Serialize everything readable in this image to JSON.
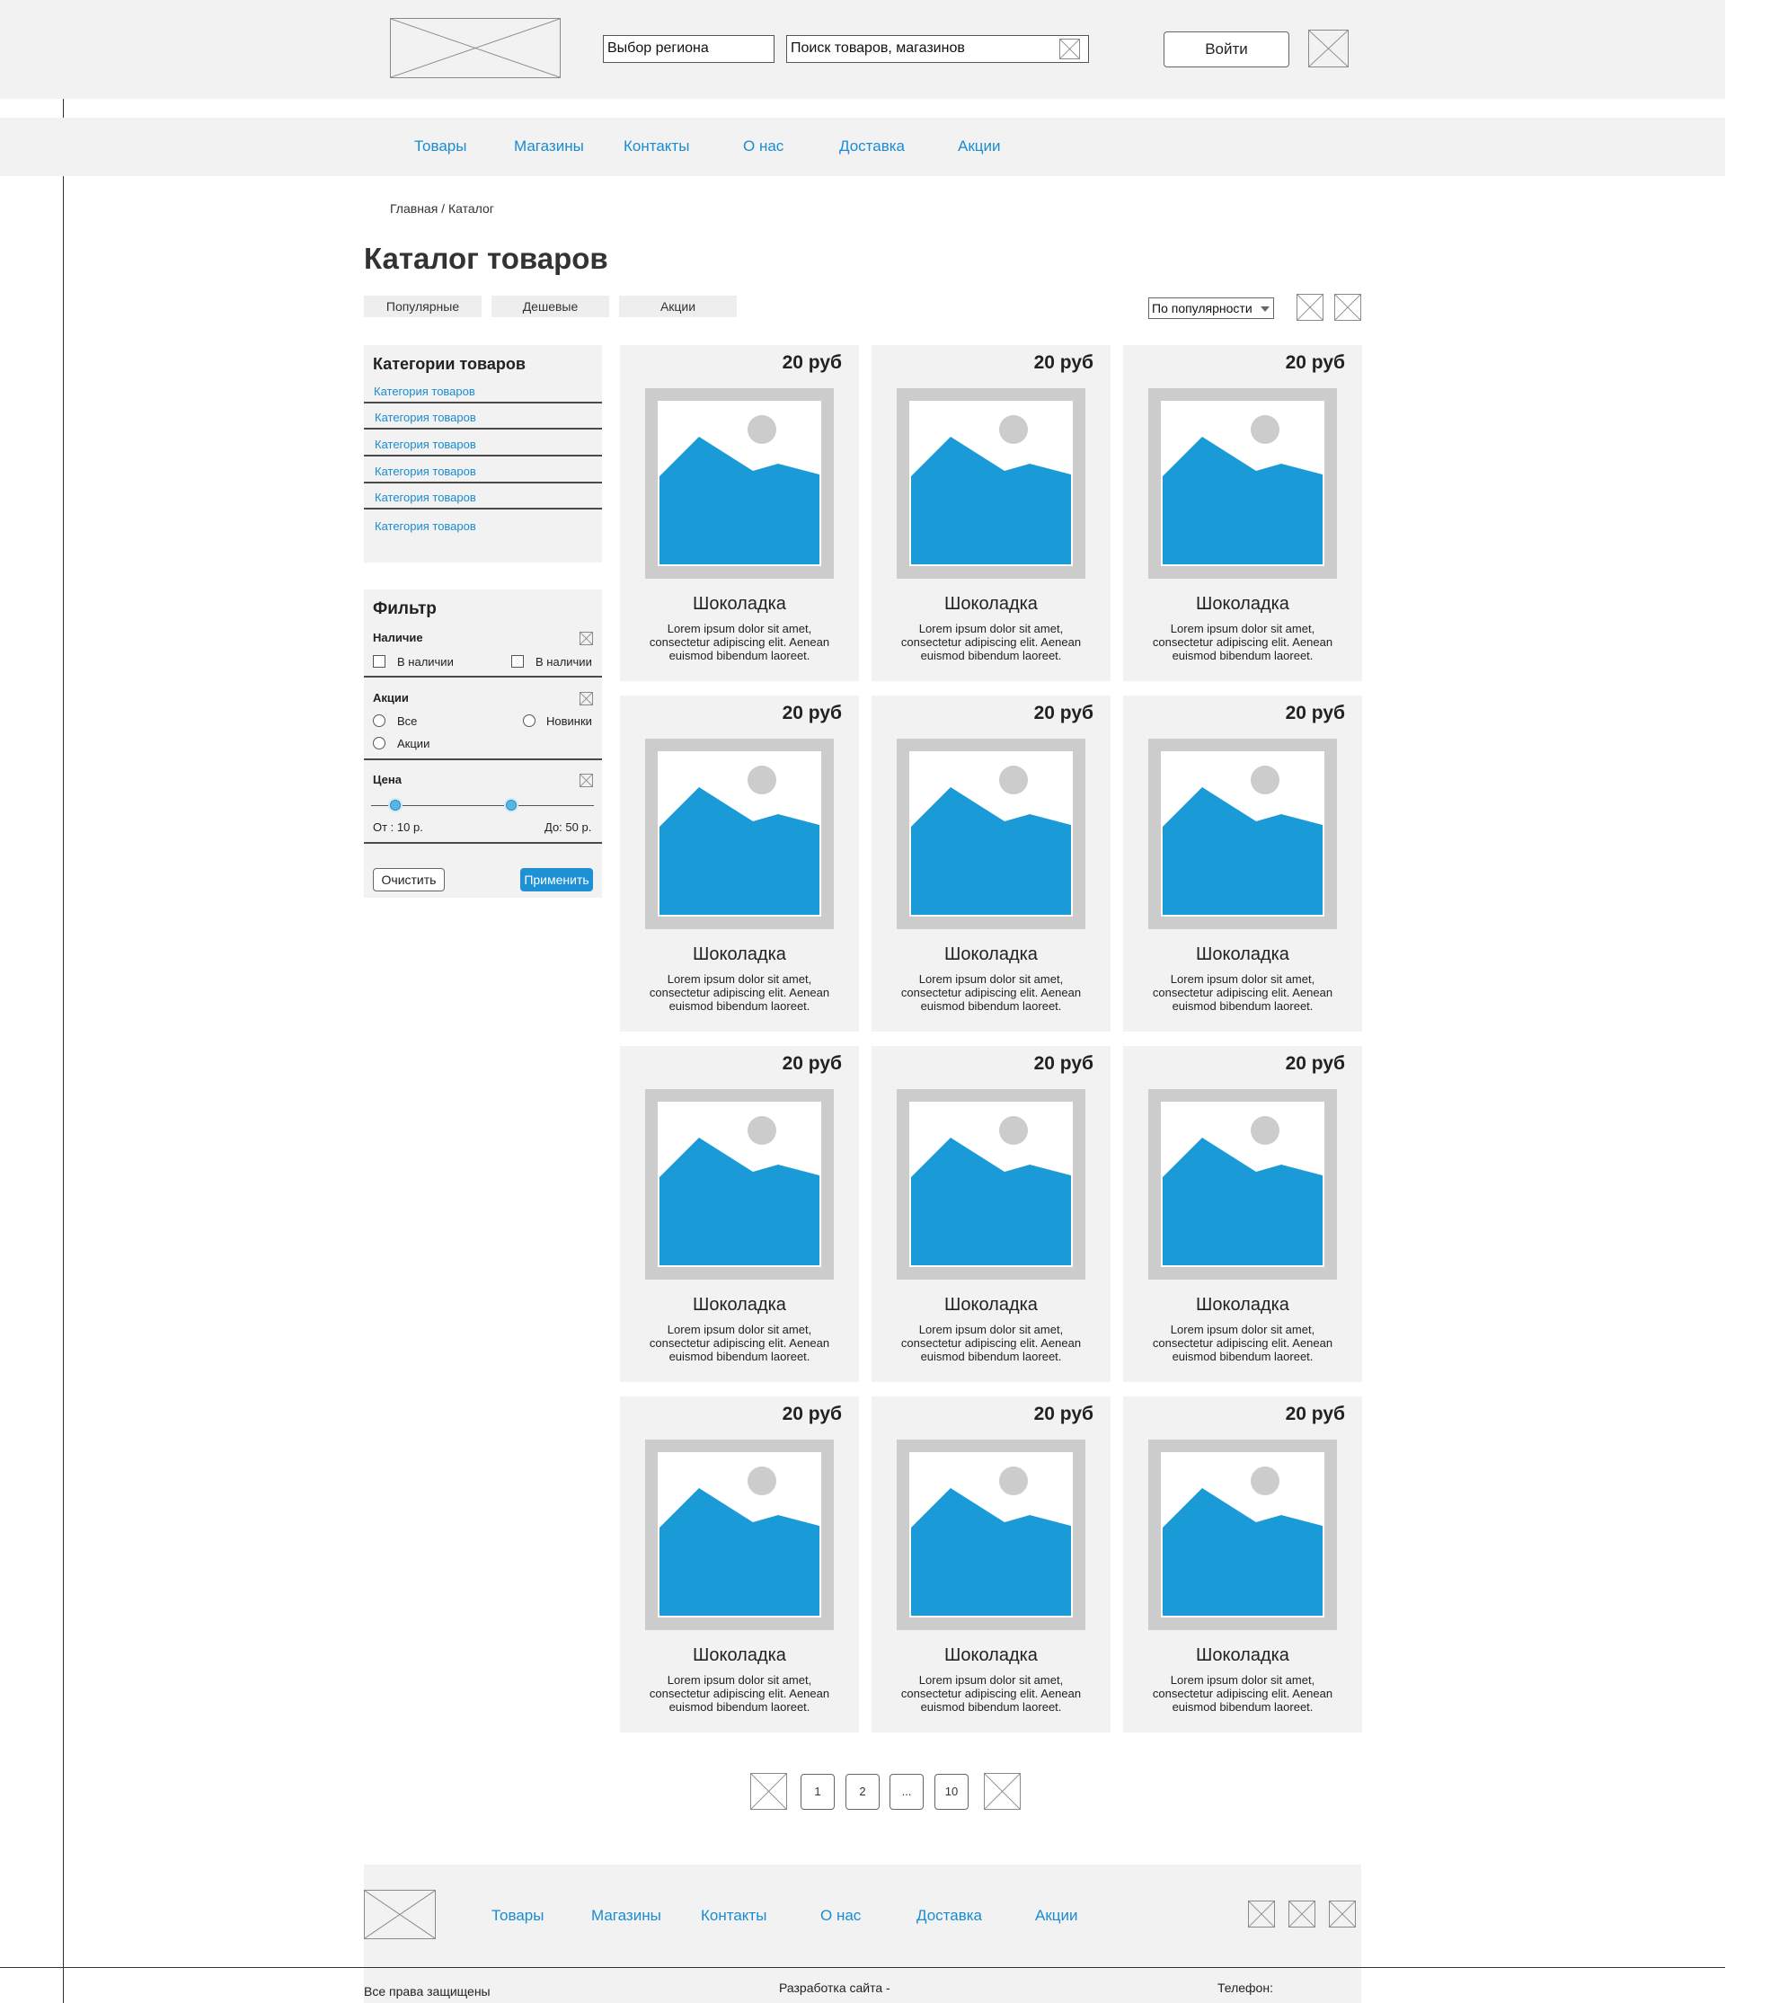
{
  "header": {
    "region_value": "Выбор региона",
    "search_value": "Поиск товаров, магазинов",
    "login_label": "Войти"
  },
  "nav": [
    "Товары",
    "Магазины",
    "Контакты",
    "О нас",
    "Доставка",
    "Акции"
  ],
  "breadcrumb": "Главная / Каталог",
  "page_title": "Каталог товаров",
  "quick_filters": [
    "Популярные",
    "Дешевые",
    "Акции"
  ],
  "sort_value": "По популярности",
  "categories": {
    "title": "Категории товаров",
    "items": [
      "Категория товаров",
      "Категория товаров",
      "Категория товаров",
      "Категория товаров",
      "Категория товаров",
      "Категория товаров"
    ]
  },
  "filter": {
    "title": "Фильтр",
    "availability": {
      "label": "Наличие",
      "options": [
        "В наличии",
        "В наличии"
      ]
    },
    "promo": {
      "label": "Акции",
      "options": [
        "Все",
        "Новинки",
        "Акции"
      ]
    },
    "price": {
      "label": "Цена",
      "from": "От : 10 р.",
      "to": "До: 50 р.",
      "range_min_pct": 0.11,
      "range_max_pct": 0.63
    },
    "clear_label": "Очистить",
    "apply_label": "Применить"
  },
  "products": [
    {
      "price": "20 руб",
      "name": "Шоколадка",
      "desc": "Lorem ipsum dolor sit amet, consectetur adipiscing elit. Aenean euismod bibendum laoreet."
    },
    {
      "price": "20 руб",
      "name": "Шоколадка",
      "desc": "Lorem ipsum dolor sit amet, consectetur adipiscing elit. Aenean euismod bibendum laoreet."
    },
    {
      "price": "20 руб",
      "name": "Шоколадка",
      "desc": "Lorem ipsum dolor sit amet, consectetur adipiscing elit. Aenean euismod bibendum laoreet."
    },
    {
      "price": "20 руб",
      "name": "Шоколадка",
      "desc": "Lorem ipsum dolor sit amet, consectetur adipiscing elit. Aenean euismod bibendum laoreet."
    },
    {
      "price": "20 руб",
      "name": "Шоколадка",
      "desc": "Lorem ipsum dolor sit amet, consectetur adipiscing elit. Aenean euismod bibendum laoreet."
    },
    {
      "price": "20 руб",
      "name": "Шоколадка",
      "desc": "Lorem ipsum dolor sit amet, consectetur adipiscing elit. Aenean euismod bibendum laoreet."
    },
    {
      "price": "20 руб",
      "name": "Шоколадка",
      "desc": "Lorem ipsum dolor sit amet, consectetur adipiscing elit. Aenean euismod bibendum laoreet."
    },
    {
      "price": "20 руб",
      "name": "Шоколадка",
      "desc": "Lorem ipsum dolor sit amet, consectetur adipiscing elit. Aenean euismod bibendum laoreet."
    },
    {
      "price": "20 руб",
      "name": "Шоколадка",
      "desc": "Lorem ipsum dolor sit amet, consectetur adipiscing elit. Aenean euismod bibendum laoreet."
    },
    {
      "price": "20 руб",
      "name": "Шоколадка",
      "desc": "Lorem ipsum dolor sit amet, consectetur adipiscing elit. Aenean euismod bibendum laoreet."
    },
    {
      "price": "20 руб",
      "name": "Шоколадка",
      "desc": "Lorem ipsum dolor sit amet, consectetur adipiscing elit. Aenean euismod bibendum laoreet."
    },
    {
      "price": "20 руб",
      "name": "Шоколадка",
      "desc": "Lorem ipsum dolor sit amet, consectetur adipiscing elit. Aenean euismod bibendum laoreet."
    }
  ],
  "pagination": [
    "1",
    "2",
    "...",
    "10"
  ],
  "footer": {
    "nav": [
      "Товары",
      "Магазины",
      "Контакты",
      "О нас",
      "Доставка",
      "Акции"
    ],
    "rights": "Все права защищены",
    "dev": "Разработка сайта -",
    "phone": "Телефон:"
  },
  "colors": {
    "accent": "#1a8ccf",
    "panel_bg": "#f2f2f2",
    "image_blue": "#1a9ad6",
    "apply_btn": "#1e90d6"
  }
}
